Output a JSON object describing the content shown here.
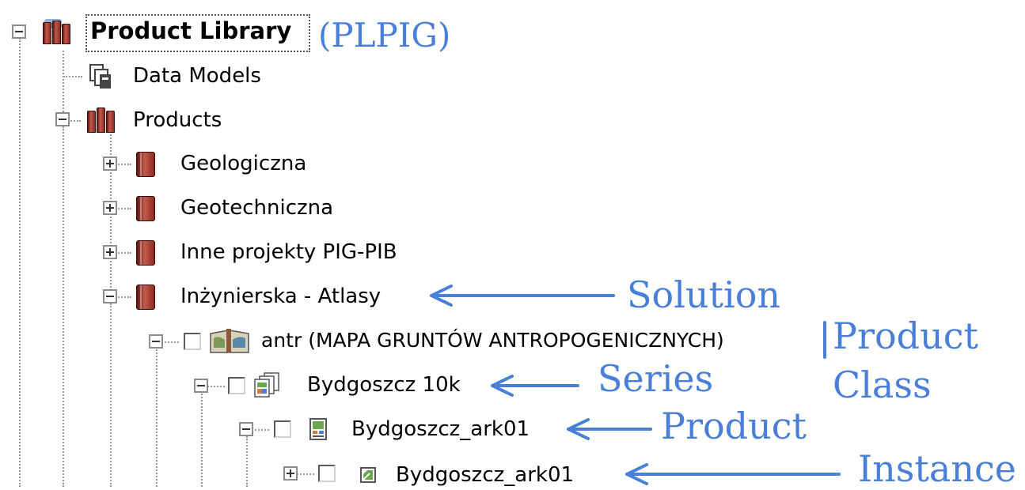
{
  "tree": {
    "root": {
      "label": "Product Library",
      "tag": "(PLPIG)",
      "icon": "library-books-icon"
    },
    "data_models": {
      "label": "Data Models",
      "icon": "documents-icon"
    },
    "products": {
      "label": "Products",
      "icon": "library-books-icon"
    },
    "geologiczna": {
      "label": "Geologiczna",
      "icon": "book-icon"
    },
    "geotechniczna": {
      "label": "Geotechniczna",
      "icon": "book-icon"
    },
    "inne": {
      "label": "Inne projekty PIG-PIB",
      "icon": "book-icon"
    },
    "inzynierska": {
      "label": "Inżynierska - Atlasy",
      "icon": "book-icon"
    },
    "antr": {
      "label": "antr (MAPA GRUNTÓW ANTROPOGENICZNYCH)",
      "icon": "atlas-icon"
    },
    "series": {
      "label": "Bydgoszcz 10k",
      "icon": "map-series-icon"
    },
    "product": {
      "label": "Bydgoszcz_ark01",
      "icon": "map-sheet-icon"
    },
    "instance": {
      "label": "Bydgoszcz_ark01",
      "icon": "map-instance-icon"
    }
  },
  "annotations": {
    "solution": "Solution",
    "product_class_line1": "Product",
    "product_class_line2": "Class",
    "series": "Series",
    "product": "Product",
    "instance": "Instance",
    "color": "#4a7fd9"
  }
}
